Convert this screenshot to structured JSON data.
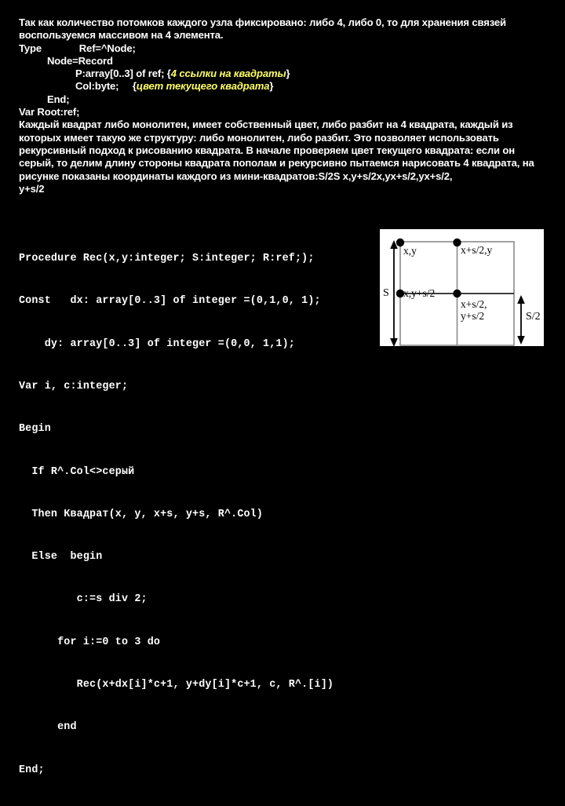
{
  "slide": {
    "background_color": "#000000",
    "text_color": "#ffffff",
    "comment_color": "#ffff66"
  },
  "prose": {
    "intro": [
      "Так как количество потомков каждого узла фиксировано: либо 4, либо 0, то для хранения связей воспользуемся массивом на 4 элемента."
    ],
    "type_block": {
      "type_keyword": "Type",
      "ref_decl": "Ref=^Node;",
      "node_decl": "Node=Record",
      "p_field": "P:array[0..3] of ref;",
      "p_comment_open": "{",
      "p_comment": "4 ссылки на квадраты",
      "p_comment_close": "}",
      "col_field": "Col:byte;",
      "col_comment_open": "{",
      "col_comment": "цвет текущего квадрата",
      "col_comment_close": "}",
      "end_decl": "End;"
    },
    "var_root": "Var Root:ref;",
    "body_paragraph": "Каждый квадрат либо монолитен, имеет собственный цвет, либо разбит на 4 квадрата, каждый из которых имеет такую же структуру: либо монолитен, либо разбит. Это позволяет использовать рекурсивный подход к рисованию квадрата. В начале проверяем цвет текущего квадрата: если он серый, то делим длину стороны квадрата пополам и рекурсивно пытаемся нарисовать 4 квадрата, на рисунке показаны координаты каждого из мини-квадратов:S/2S x,y+s/2x,yx+s/2,yx+s/2,",
    "body_tail": "y+s/2"
  },
  "code": {
    "lines": [
      "Procedure Rec(x,y:integer; S:integer; R:ref;);",
      "Const   dx: array[0..3] of integer =(0,1,0, 1);",
      "    dy: array[0..3] of integer =(0,0, 1,1);",
      "Var i, c:integer;",
      "Begin",
      "  If R^.Col<>серый",
      "  Then Квадрат(x, y, x+s, y+s, R^.Col)",
      "  Else  begin",
      "         c:=s div 2;",
      "      for i:=0 to 3 do",
      "         Rec(x+dx[i]*c+1, y+dy[i]*c+1, c, R^.[i])",
      "      end",
      "End;"
    ]
  },
  "figure": {
    "title": "square-subdivision-diagram",
    "background": "#ffffff",
    "line_color": "#808080",
    "dot_color": "#000000",
    "labels": {
      "top_left": "x,y",
      "top_right": "x+s/2,y",
      "bottom_left": "x,y+s/2",
      "bottom_right_line1": "x+s/2,",
      "bottom_right_line2": "y+s/2",
      "left_arrow": "S",
      "right_arrow": "S/2"
    }
  }
}
